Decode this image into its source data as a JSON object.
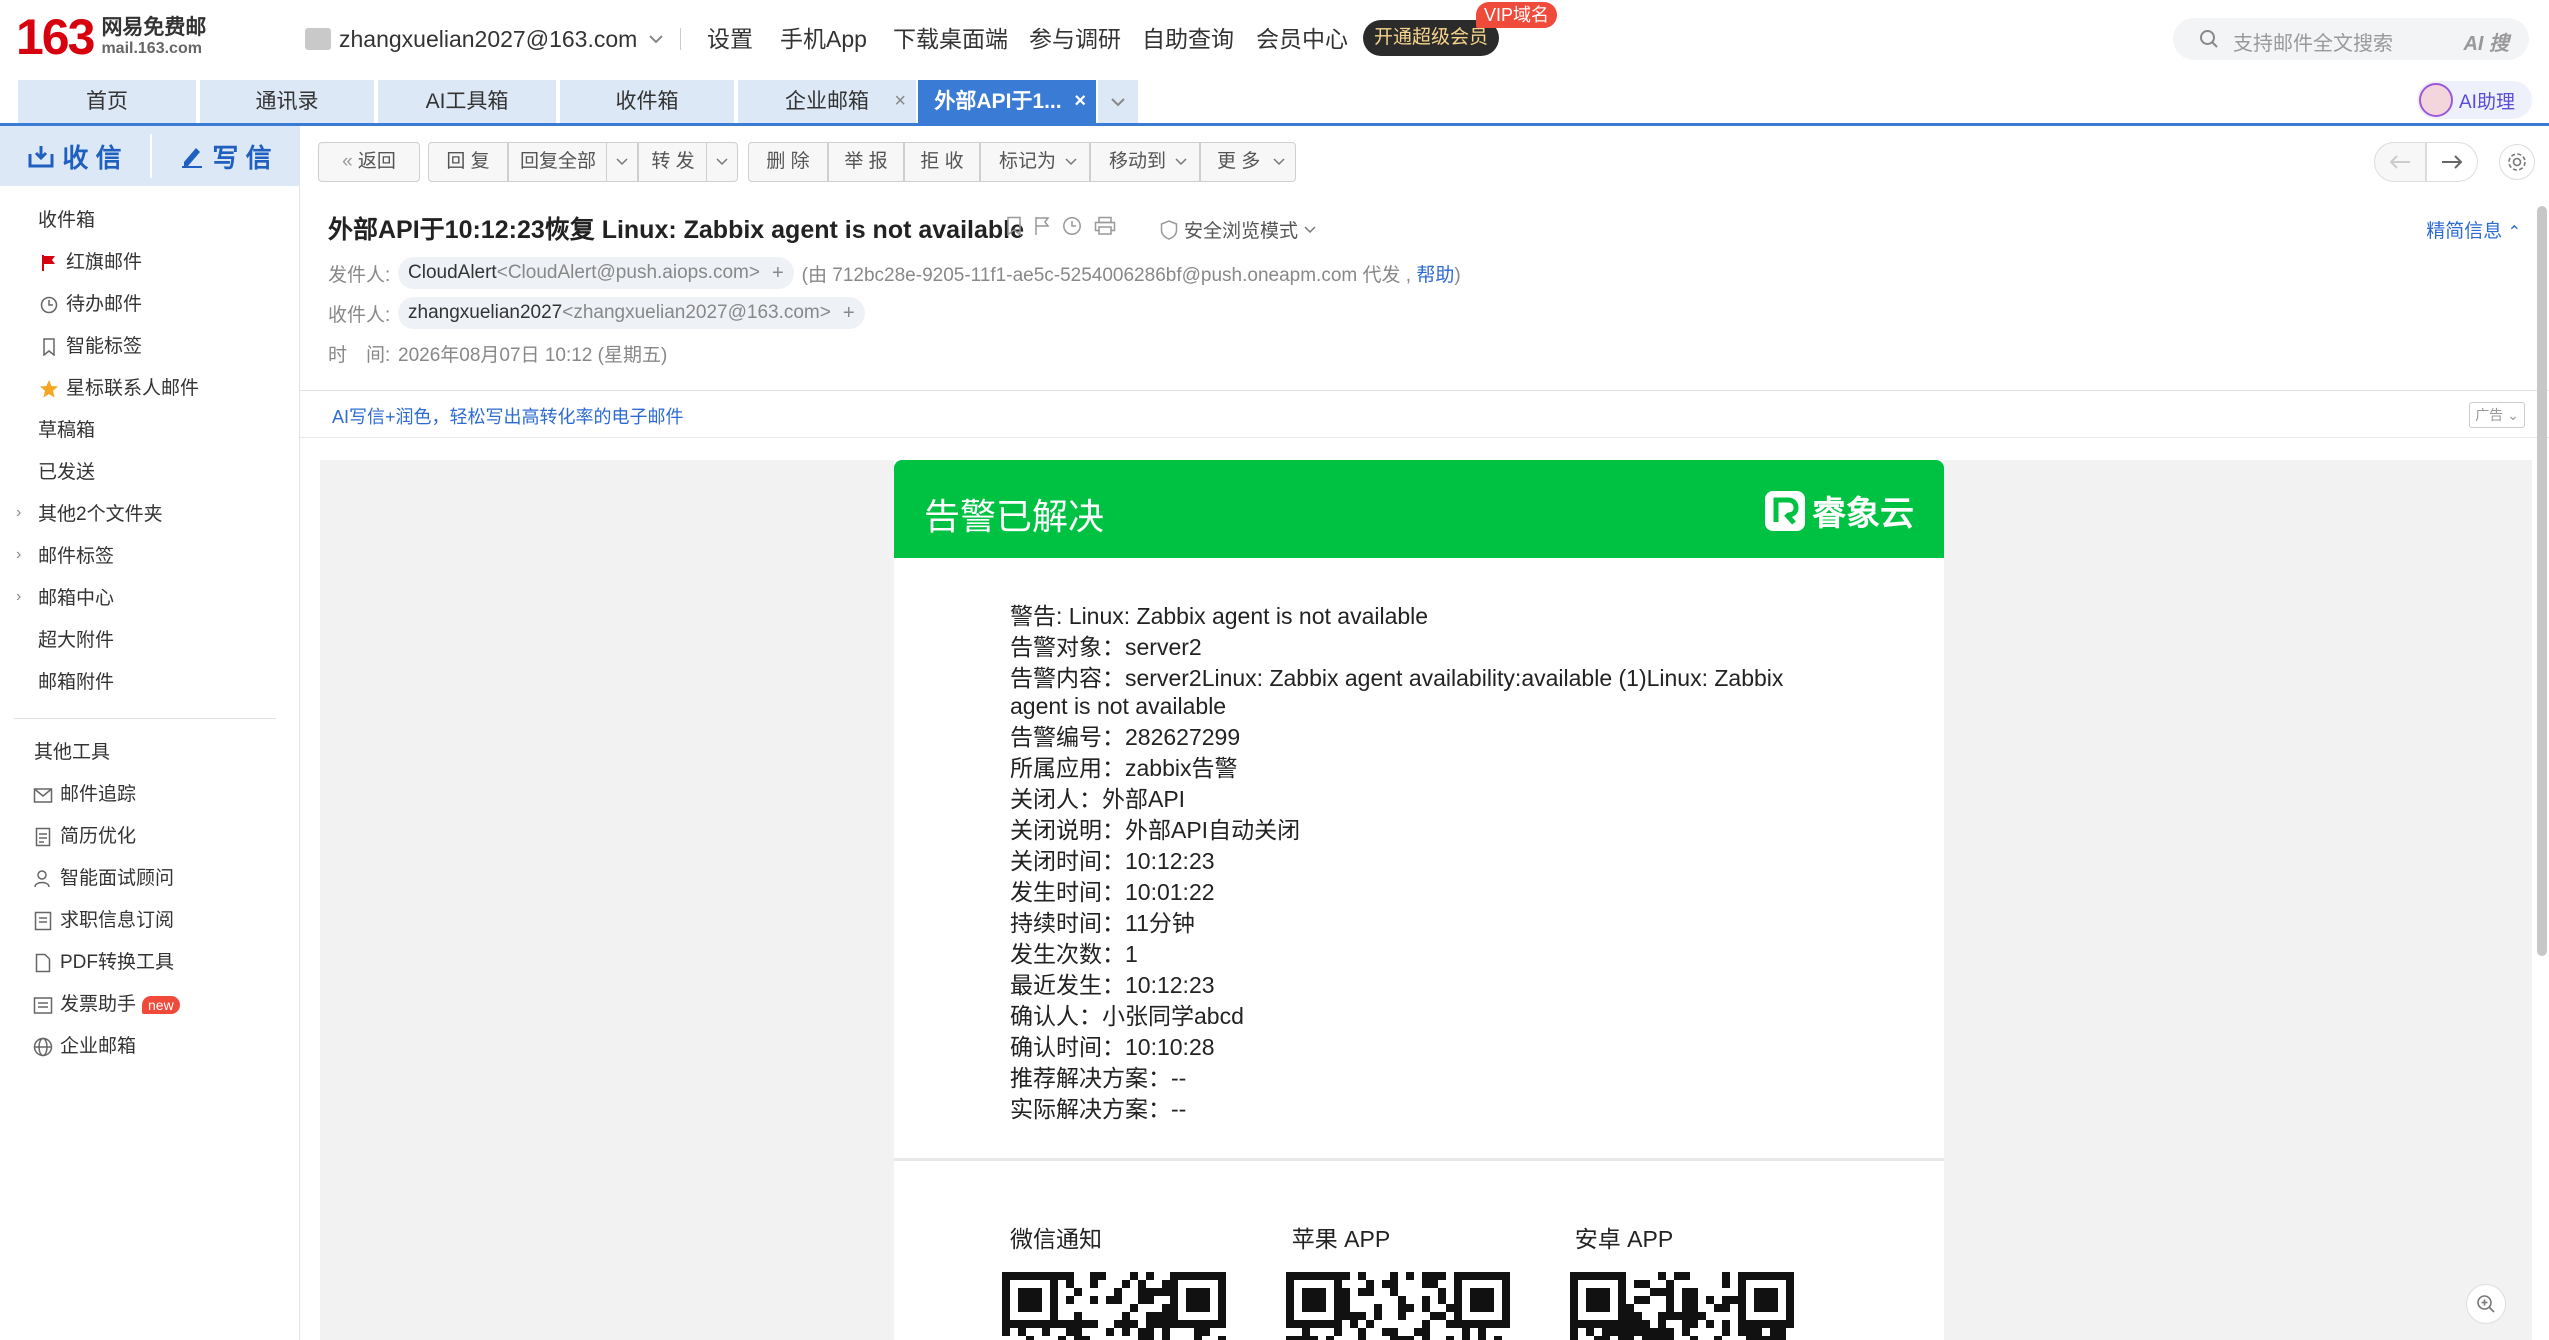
{
  "brand": {
    "logo_number": "163",
    "logo_cn": "网易免费邮",
    "logo_en": "mail.163.com"
  },
  "account": {
    "email": "zhangxuelian2027@163.com"
  },
  "topnav": {
    "settings": "设置",
    "mobile_app": "手机App",
    "desktop": "下载桌面端",
    "survey": "参与调研",
    "self_query": "自助查询",
    "member_center": "会员中心",
    "vip_button": "开通超级会员",
    "vip_badge": "VIP域名"
  },
  "search": {
    "placeholder": "支持邮件全文搜索",
    "ai_label": "AI 搜"
  },
  "tabs": [
    {
      "label": "首页"
    },
    {
      "label": "通讯录"
    },
    {
      "label": "AI工具箱"
    },
    {
      "label": "收件箱"
    },
    {
      "label": "企业邮箱"
    },
    {
      "label": "外部API于1..."
    }
  ],
  "ai_assistant": {
    "label": "AI助理"
  },
  "sidebar": {
    "receive": "收 信",
    "write": "写 信",
    "folders": [
      {
        "label": "收件箱"
      },
      {
        "label": "红旗邮件"
      },
      {
        "label": "待办邮件"
      },
      {
        "label": "智能标签"
      },
      {
        "label": "星标联系人邮件"
      },
      {
        "label": "草稿箱"
      },
      {
        "label": "已发送"
      },
      {
        "label": "其他2个文件夹"
      },
      {
        "label": "邮件标签"
      },
      {
        "label": "邮箱中心"
      },
      {
        "label": "超大附件"
      },
      {
        "label": "邮箱附件"
      }
    ],
    "tools_title": "其他工具",
    "tools": [
      {
        "label": "邮件追踪"
      },
      {
        "label": "简历优化"
      },
      {
        "label": "智能面试顾问"
      },
      {
        "label": "求职信息订阅"
      },
      {
        "label": "PDF转换工具"
      },
      {
        "label": "发票助手"
      },
      {
        "label": "企业邮箱"
      }
    ],
    "new_badge": "new"
  },
  "toolbar": {
    "back": "返回",
    "reply": "回 复",
    "reply_all": "回复全部",
    "forward": "转 发",
    "delete": "删 除",
    "report": "举 报",
    "reject": "拒 收",
    "mark_as": "标记为",
    "move_to": "移动到",
    "more": "更 多"
  },
  "mail": {
    "subject": "外部API于10:12:23恢复 Linux: Zabbix agent is not available",
    "safe_mode": "安全浏览模式",
    "brief_info": "精简信息",
    "from_label": "发件人:",
    "from_name": "CloudAlert",
    "from_addr": "<CloudAlert@push.aiops.com>",
    "from_extra": "(由 712bc28e-9205-11f1-ae5c-5254006286bf@push.oneapm.com 代发 ,",
    "help": "帮助",
    "from_extra_end": ")",
    "to_label": "收件人:",
    "to_name": "zhangxuelian2027",
    "to_addr": "<zhangxuelian2027@163.com>",
    "time_label": "时　间:",
    "time_value": "2026年08月07日 10:12 (星期五)"
  },
  "ad": {
    "text": "AI写信+润色，轻松写出高转化率的电子邮件",
    "tag": "广告"
  },
  "alert_card": {
    "title": "告警已解决",
    "brand_name": "睿象云",
    "lines": [
      "警告: Linux: Zabbix agent is not available",
      "告警对象：server2",
      "告警内容：server2Linux: Zabbix agent availability:available (1)Linux: Zabbix agent is not available",
      "告警编号：282627299",
      "所属应用：zabbix告警",
      "关闭人：外部API",
      "关闭说明：外部API自动关闭",
      "关闭时间：10:12:23",
      "发生时间：10:01:22",
      "持续时间：11分钟",
      "发生次数：1",
      "最近发生：10:12:23",
      "确认人：小张同学abcd",
      "确认时间：10:10:28",
      "推荐解决方案：--",
      "实际解决方案：--"
    ],
    "qr_labels": [
      "微信通知",
      "苹果 APP",
      "安卓 APP"
    ]
  },
  "colors": {
    "brand_red": "#d7000f",
    "tab_active": "#3a7bd5",
    "alert_green": "#00c242",
    "link_blue": "#2d6bd3"
  }
}
